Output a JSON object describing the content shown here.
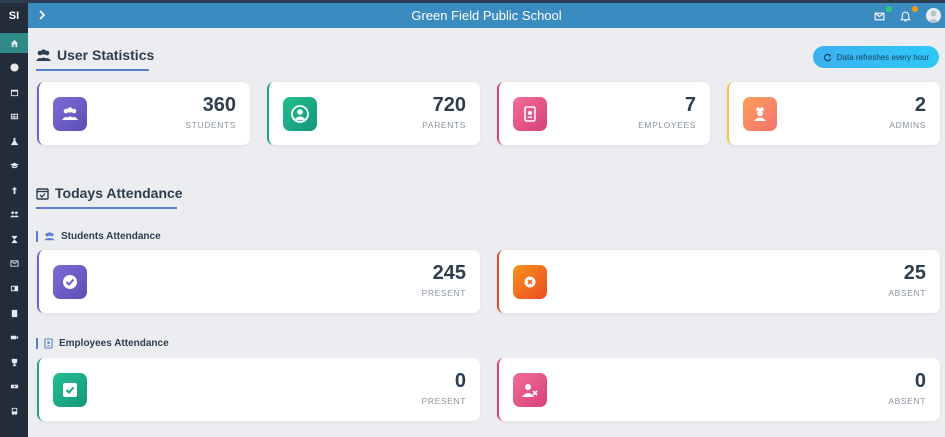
{
  "app": {
    "logo_text": "SI",
    "title": "Green Field Public School"
  },
  "header": {
    "mail_badge_color": "#2ecc71",
    "bell_badge_color": "#f39c12"
  },
  "user_statistics": {
    "heading": "User Statistics",
    "refresh_note": "Data refreshes every hour",
    "cards": [
      {
        "value": "360",
        "label": "STUDENTS",
        "icon": "users-icon",
        "color": "#6e63c8"
      },
      {
        "value": "720",
        "label": "PARENTS",
        "icon": "user-circle-icon",
        "color": "#1aa683"
      },
      {
        "value": "7",
        "label": "EMPLOYEES",
        "icon": "id-badge-icon",
        "color": "#e0426b"
      },
      {
        "value": "2",
        "label": "ADMINS",
        "icon": "user-secret-icon",
        "color": "#f5c542"
      }
    ]
  },
  "attendance": {
    "heading": "Todays Attendance",
    "students": {
      "heading": "Students Attendance",
      "present": {
        "value": "245",
        "label": "PRESENT"
      },
      "absent": {
        "value": "25",
        "label": "ABSENT"
      }
    },
    "employees": {
      "heading": "Employees Attendance",
      "present": {
        "value": "0",
        "label": "PRESENT"
      },
      "absent": {
        "value": "0",
        "label": "ABSENT"
      }
    }
  },
  "sidebar": {
    "items": [
      "dashboard-icon",
      "circle-icon",
      "calendar-icon",
      "table-icon",
      "flask-icon",
      "graduation-cap-icon",
      "upload-icon",
      "users-icon",
      "hourglass-icon",
      "envelope-icon",
      "id-card-icon",
      "book-icon",
      "video-icon",
      "trophy-icon",
      "money-icon",
      "bus-icon"
    ]
  }
}
